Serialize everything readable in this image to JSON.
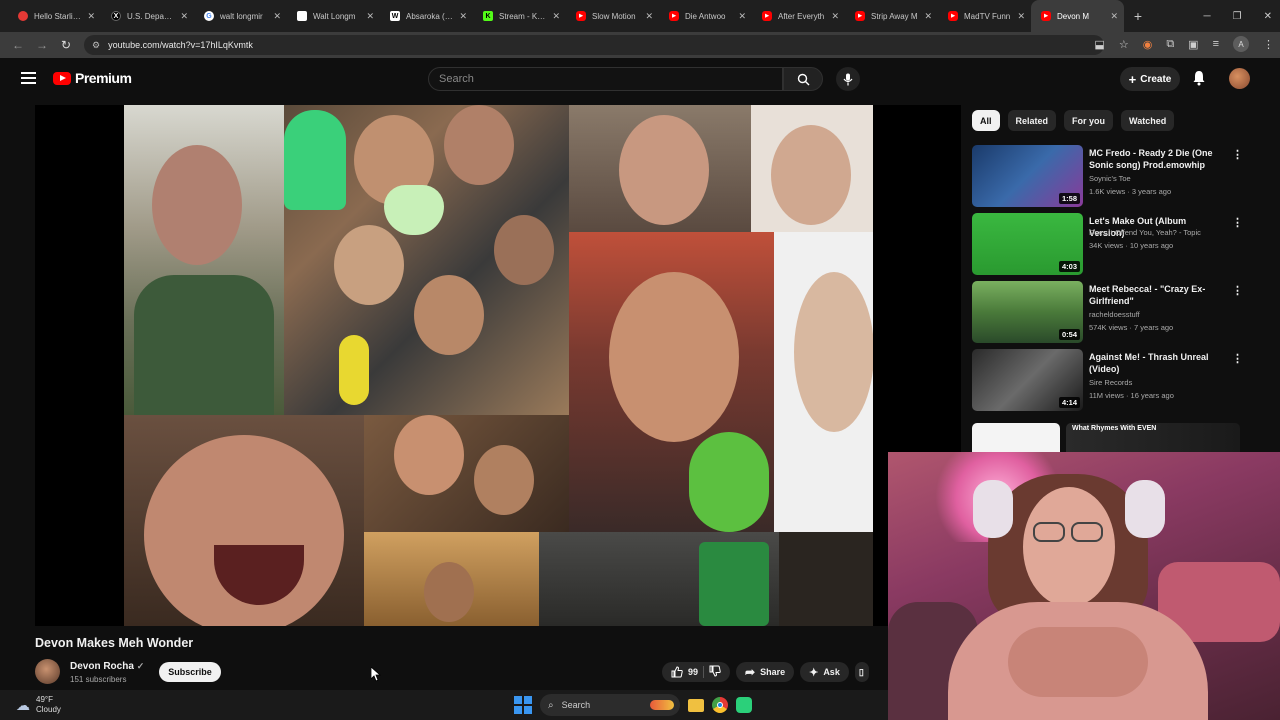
{
  "browser": {
    "tabs": [
      {
        "title": "Hello Starling",
        "icon_color": "#e53935",
        "icon": "circle"
      },
      {
        "title": "U.S. Departm",
        "icon_color": "#000000",
        "icon": "X"
      },
      {
        "title": "walt longmir",
        "icon_color": "#ffffff",
        "icon": "G"
      },
      {
        "title": "Walt Longm",
        "icon_color": "#ffffff",
        "icon": "doc"
      },
      {
        "title": "Absaroka (pe",
        "icon_color": "#ffffff",
        "icon": "W"
      },
      {
        "title": "Stream - Kick",
        "icon_color": "#53fc18",
        "icon": "K"
      },
      {
        "title": "Slow Motion",
        "icon_color": "#ff0000",
        "icon": "yt"
      },
      {
        "title": "Die Antwoo",
        "icon_color": "#ff0000",
        "icon": "yt"
      },
      {
        "title": "After Everyth",
        "icon_color": "#ff0000",
        "icon": "yt"
      },
      {
        "title": "Strip Away M",
        "icon_color": "#ff0000",
        "icon": "yt"
      },
      {
        "title": "MadTV Funn",
        "icon_color": "#ff0000",
        "icon": "yt"
      },
      {
        "title": "Devon M",
        "icon_color": "#ff0000",
        "icon": "yt",
        "active": true
      }
    ],
    "new_tab": "+",
    "url": "youtube.com/watch?v=17hILqKvmtk"
  },
  "youtube": {
    "logo_text": "Premium",
    "search_placeholder": "Search",
    "create_label": "Create"
  },
  "video": {
    "title": "Devon Makes Meh Wonder",
    "channel": "Devon Rocha",
    "verified": "✓",
    "subscribers": "151 subscribers",
    "subscribe_label": "Subscribe",
    "likes": "99",
    "share_label": "Share",
    "ask_label": "Ask"
  },
  "chips": [
    "All",
    "Related",
    "For you",
    "Watched"
  ],
  "recommendations": [
    {
      "title": "MC Fredo - Ready 2 Die (One Sonic song) Prod.emowhip",
      "channel": "Soynic's Toe",
      "meta": "1.6K views · 3 years ago",
      "duration": "1:58"
    },
    {
      "title": "Let's Make Out (Album Version)",
      "channel": "Does It Offend You, Yeah? - Topic",
      "meta": "34K views · 10 years ago",
      "duration": "4:03"
    },
    {
      "title": "Meet Rebecca! - \"Crazy Ex-Girlfriend\"",
      "channel": "racheldoesstuff",
      "meta": "574K views · 7 years ago",
      "duration": "0:54"
    },
    {
      "title": "Against Me! - Thrash Unreal (Video)",
      "channel": "Sire Records",
      "meta": "11M views · 16 years ago",
      "duration": "4:14"
    }
  ],
  "partial_thumb_text": "What Rhymes With EVEN",
  "taskbar": {
    "temperature": "49°F",
    "condition": "Cloudy",
    "search_label": "Search"
  }
}
